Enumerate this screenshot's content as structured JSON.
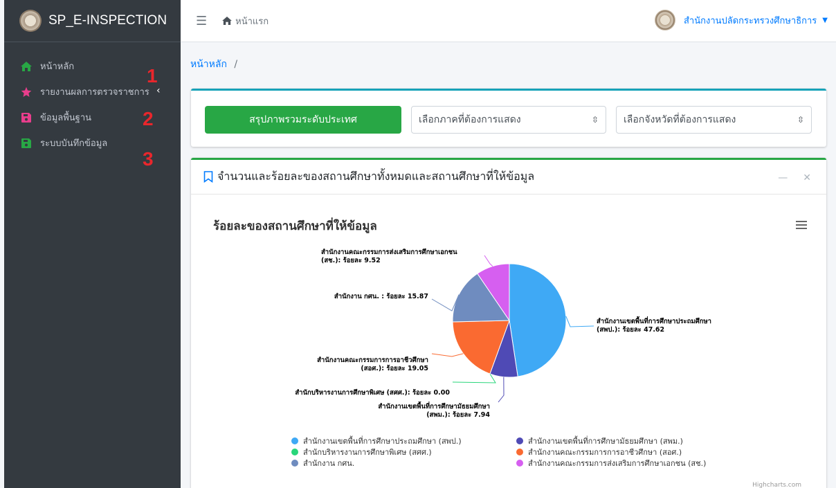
{
  "brand": {
    "title": "SP_E-INSPECTION"
  },
  "sidebar": {
    "items": [
      {
        "label": "หน้าหลัก",
        "icon": "home-icon",
        "color": "#28a745"
      },
      {
        "label": "รายงานผลการตรวจราชการ",
        "icon": "star-icon",
        "color": "#e83e8c"
      },
      {
        "label": "ข้อมูลพื้นฐาน",
        "icon": "save-icon",
        "color": "#e83e8c"
      },
      {
        "label": "ระบบบันทึกข้อมูล",
        "icon": "save-icon",
        "color": "#28a745"
      }
    ],
    "caret": "‹",
    "markers": [
      "1",
      "2",
      "3"
    ]
  },
  "navbar": {
    "home_label": "หน้าแรก",
    "user_name": "สำนักงานปลัดกระทรวงศึกษาธิการ"
  },
  "breadcrumb": {
    "home": "หน้าหลัก",
    "separator": "/"
  },
  "filters": {
    "summary_button": "สรุปภาพรวมระดับประเทศ",
    "region_select": "เลือกภาคที่ต้องการแสดง",
    "province_select": "เลือกจังหวัดที่ต้องการแสดง"
  },
  "card": {
    "title": "จำนวนและร้อยละของสถานศึกษาทั้งหมดและสถานศึกษาที่ให้ข้อมูล",
    "credit": "Highcharts.com"
  },
  "chart_data": {
    "type": "pie",
    "title": "ร้อยละของสถานศึกษาที่ให้ข้อมูล",
    "slices": [
      {
        "label": "สำนักงานเขตพื้นที่การศึกษาประถมศึกษา (สพป.)",
        "value": 47.62,
        "color": "#3fa9f5",
        "data_label": [
          "สำนักงานเขตพื้นที่การศึกษาประถมศึกษา",
          "(สพป.): ร้อยละ 47.62"
        ]
      },
      {
        "label": "สำนักงานเขตพื้นที่การศึกษามัธยมศึกษา (สพม.)",
        "value": 7.94,
        "color": "#4f4ab5",
        "data_label": [
          "สำนักงานเขตพื้นที่การศึกษามัธยมศึกษา",
          "(สพม.): ร้อยละ 7.94"
        ]
      },
      {
        "label": "สำนักบริหารงานการศึกษาพิเศษ (สศศ.)",
        "value": 0.0,
        "color": "#28d67a",
        "data_label": [
          "สำนักบริหารงานการศึกษาพิเศษ (สศศ.): ร้อยละ 0.00"
        ]
      },
      {
        "label": "สำนักงานคณะกรรมการการอาชีวศึกษา (สอศ.)",
        "value": 19.05,
        "color": "#fa6a31",
        "data_label": [
          "สำนักงานคณะกรรมการการอาชีวศึกษา",
          "(สอศ.): ร้อยละ 19.05"
        ]
      },
      {
        "label": "สำนักงาน กศน.",
        "value": 15.87,
        "color": "#6f8cbf",
        "data_label": [
          "สำนักงาน กศน. : ร้อยละ 15.87"
        ]
      },
      {
        "label": "สำนักงานคณะกรรมการส่งเสริมการศึกษาเอกชน (สช.)",
        "value": 9.52,
        "color": "#d65ff0",
        "data_label": [
          "สำนักงานคณะกรรมการส่งเสริมการศึกษาเอกชน",
          "(สช.): ร้อยละ 9.52"
        ]
      }
    ],
    "legend_placement": "bottom"
  }
}
